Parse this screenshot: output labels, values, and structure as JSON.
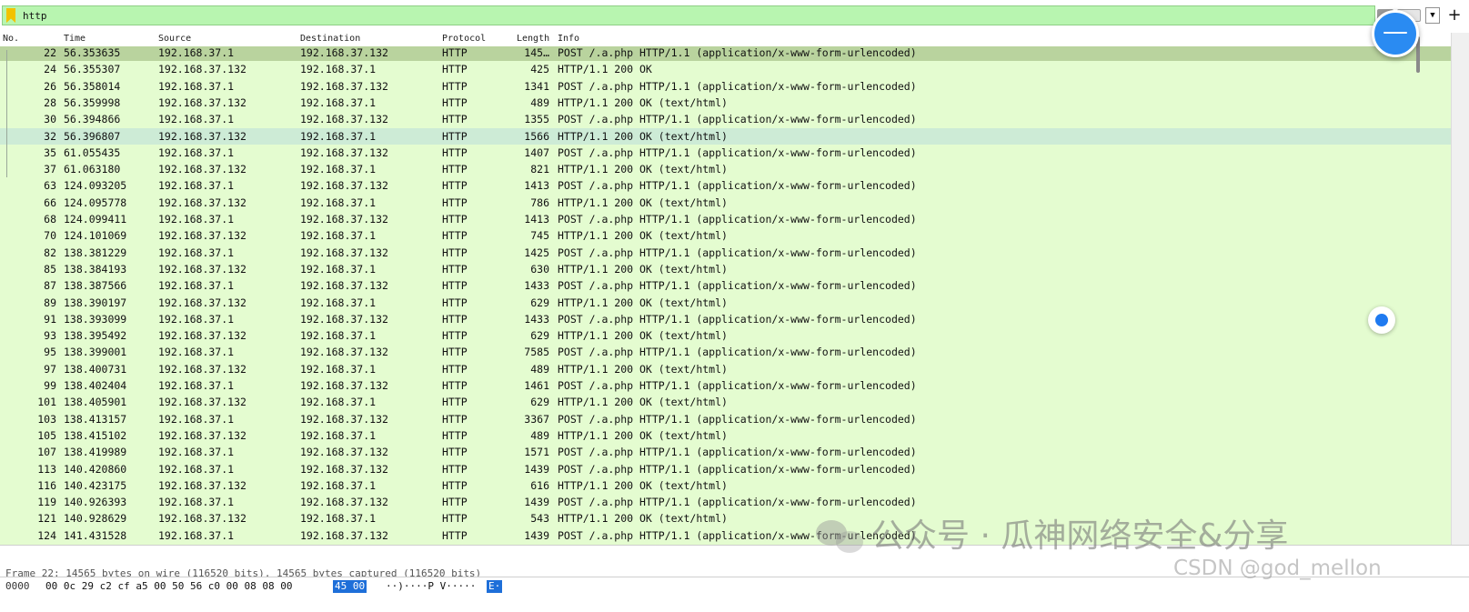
{
  "filter": {
    "value": "http"
  },
  "columns": {
    "no": "No.",
    "time": "Time",
    "source": "Source",
    "destination": "Destination",
    "protocol": "Protocol",
    "length": "Length",
    "info": "Info"
  },
  "packets": [
    {
      "no": "22",
      "time": "56.353635",
      "src": "192.168.37.1",
      "dst": "192.168.37.132",
      "proto": "HTTP",
      "len": "145…",
      "info": "POST /.a.php HTTP/1.1  (application/x-www-form-urlencoded)"
    },
    {
      "no": "24",
      "time": "56.355307",
      "src": "192.168.37.132",
      "dst": "192.168.37.1",
      "proto": "HTTP",
      "len": "425",
      "info": "HTTP/1.1 200 OK"
    },
    {
      "no": "26",
      "time": "56.358014",
      "src": "192.168.37.1",
      "dst": "192.168.37.132",
      "proto": "HTTP",
      "len": "1341",
      "info": "POST /.a.php HTTP/1.1  (application/x-www-form-urlencoded)"
    },
    {
      "no": "28",
      "time": "56.359998",
      "src": "192.168.37.132",
      "dst": "192.168.37.1",
      "proto": "HTTP",
      "len": "489",
      "info": "HTTP/1.1 200 OK  (text/html)"
    },
    {
      "no": "30",
      "time": "56.394866",
      "src": "192.168.37.1",
      "dst": "192.168.37.132",
      "proto": "HTTP",
      "len": "1355",
      "info": "POST /.a.php HTTP/1.1  (application/x-www-form-urlencoded)"
    },
    {
      "no": "32",
      "time": "56.396807",
      "src": "192.168.37.132",
      "dst": "192.168.37.1",
      "proto": "HTTP",
      "len": "1566",
      "info": "HTTP/1.1 200 OK  (text/html)"
    },
    {
      "no": "35",
      "time": "61.055435",
      "src": "192.168.37.1",
      "dst": "192.168.37.132",
      "proto": "HTTP",
      "len": "1407",
      "info": "POST /.a.php HTTP/1.1  (application/x-www-form-urlencoded)"
    },
    {
      "no": "37",
      "time": "61.063180",
      "src": "192.168.37.132",
      "dst": "192.168.37.1",
      "proto": "HTTP",
      "len": "821",
      "info": "HTTP/1.1 200 OK  (text/html)"
    },
    {
      "no": "63",
      "time": "124.093205",
      "src": "192.168.37.1",
      "dst": "192.168.37.132",
      "proto": "HTTP",
      "len": "1413",
      "info": "POST /.a.php HTTP/1.1  (application/x-www-form-urlencoded)"
    },
    {
      "no": "66",
      "time": "124.095778",
      "src": "192.168.37.132",
      "dst": "192.168.37.1",
      "proto": "HTTP",
      "len": "786",
      "info": "HTTP/1.1 200 OK  (text/html)"
    },
    {
      "no": "68",
      "time": "124.099411",
      "src": "192.168.37.1",
      "dst": "192.168.37.132",
      "proto": "HTTP",
      "len": "1413",
      "info": "POST /.a.php HTTP/1.1  (application/x-www-form-urlencoded)"
    },
    {
      "no": "70",
      "time": "124.101069",
      "src": "192.168.37.132",
      "dst": "192.168.37.1",
      "proto": "HTTP",
      "len": "745",
      "info": "HTTP/1.1 200 OK  (text/html)"
    },
    {
      "no": "82",
      "time": "138.381229",
      "src": "192.168.37.1",
      "dst": "192.168.37.132",
      "proto": "HTTP",
      "len": "1425",
      "info": "POST /.a.php HTTP/1.1  (application/x-www-form-urlencoded)"
    },
    {
      "no": "85",
      "time": "138.384193",
      "src": "192.168.37.132",
      "dst": "192.168.37.1",
      "proto": "HTTP",
      "len": "630",
      "info": "HTTP/1.1 200 OK  (text/html)"
    },
    {
      "no": "87",
      "time": "138.387566",
      "src": "192.168.37.1",
      "dst": "192.168.37.132",
      "proto": "HTTP",
      "len": "1433",
      "info": "POST /.a.php HTTP/1.1  (application/x-www-form-urlencoded)"
    },
    {
      "no": "89",
      "time": "138.390197",
      "src": "192.168.37.132",
      "dst": "192.168.37.1",
      "proto": "HTTP",
      "len": "629",
      "info": "HTTP/1.1 200 OK  (text/html)"
    },
    {
      "no": "91",
      "time": "138.393099",
      "src": "192.168.37.1",
      "dst": "192.168.37.132",
      "proto": "HTTP",
      "len": "1433",
      "info": "POST /.a.php HTTP/1.1  (application/x-www-form-urlencoded)"
    },
    {
      "no": "93",
      "time": "138.395492",
      "src": "192.168.37.132",
      "dst": "192.168.37.1",
      "proto": "HTTP",
      "len": "629",
      "info": "HTTP/1.1 200 OK  (text/html)"
    },
    {
      "no": "95",
      "time": "138.399001",
      "src": "192.168.37.1",
      "dst": "192.168.37.132",
      "proto": "HTTP",
      "len": "7585",
      "info": "POST /.a.php HTTP/1.1  (application/x-www-form-urlencoded)"
    },
    {
      "no": "97",
      "time": "138.400731",
      "src": "192.168.37.132",
      "dst": "192.168.37.1",
      "proto": "HTTP",
      "len": "489",
      "info": "HTTP/1.1 200 OK  (text/html)"
    },
    {
      "no": "99",
      "time": "138.402404",
      "src": "192.168.37.1",
      "dst": "192.168.37.132",
      "proto": "HTTP",
      "len": "1461",
      "info": "POST /.a.php HTTP/1.1  (application/x-www-form-urlencoded)"
    },
    {
      "no": "101",
      "time": "138.405901",
      "src": "192.168.37.132",
      "dst": "192.168.37.1",
      "proto": "HTTP",
      "len": "629",
      "info": "HTTP/1.1 200 OK  (text/html)"
    },
    {
      "no": "103",
      "time": "138.413157",
      "src": "192.168.37.1",
      "dst": "192.168.37.132",
      "proto": "HTTP",
      "len": "3367",
      "info": "POST /.a.php HTTP/1.1  (application/x-www-form-urlencoded)"
    },
    {
      "no": "105",
      "time": "138.415102",
      "src": "192.168.37.132",
      "dst": "192.168.37.1",
      "proto": "HTTP",
      "len": "489",
      "info": "HTTP/1.1 200 OK  (text/html)"
    },
    {
      "no": "107",
      "time": "138.419989",
      "src": "192.168.37.1",
      "dst": "192.168.37.132",
      "proto": "HTTP",
      "len": "1571",
      "info": "POST /.a.php HTTP/1.1  (application/x-www-form-urlencoded)"
    },
    {
      "no": "113",
      "time": "140.420860",
      "src": "192.168.37.1",
      "dst": "192.168.37.132",
      "proto": "HTTP",
      "len": "1439",
      "info": "POST /.a.php HTTP/1.1  (application/x-www-form-urlencoded)"
    },
    {
      "no": "116",
      "time": "140.423175",
      "src": "192.168.37.132",
      "dst": "192.168.37.1",
      "proto": "HTTP",
      "len": "616",
      "info": "HTTP/1.1 200 OK  (text/html)"
    },
    {
      "no": "119",
      "time": "140.926393",
      "src": "192.168.37.1",
      "dst": "192.168.37.132",
      "proto": "HTTP",
      "len": "1439",
      "info": "POST /.a.php HTTP/1.1  (application/x-www-form-urlencoded)"
    },
    {
      "no": "121",
      "time": "140.928629",
      "src": "192.168.37.132",
      "dst": "192.168.37.1",
      "proto": "HTTP",
      "len": "543",
      "info": "HTTP/1.1 200 OK  (text/html)"
    },
    {
      "no": "124",
      "time": "141.431528",
      "src": "192.168.37.1",
      "dst": "192.168.37.132",
      "proto": "HTTP",
      "len": "1439",
      "info": "POST /.a.php HTTP/1.1  (application/x-www-form-urlencoded)"
    }
  ],
  "selected_row": 0,
  "hover_row": 5,
  "colors": {
    "row_bg": "#e4fcd0",
    "selected_bg": "#b9d39e",
    "hover_bg": "#cdebd6",
    "filter_bg": "#b8f5b0"
  },
  "details": {
    "frame_summary": "Frame 22: 14565 bytes on wire (116520 bits), 14565 bytes captured (116520 bits)"
  },
  "bytes": {
    "offset": "0000",
    "hex": "00 0c 29 c2 cf a5 00 50  56 c0 00 08 08 00",
    "hex_highlight": "45 00",
    "ascii": "··)····P V·····",
    "ascii_highlight": "E·"
  },
  "watermarks": {
    "wechat": "公众号 · 瓜神网络安全&分享",
    "csdn": "CSDN @god_mellon"
  }
}
